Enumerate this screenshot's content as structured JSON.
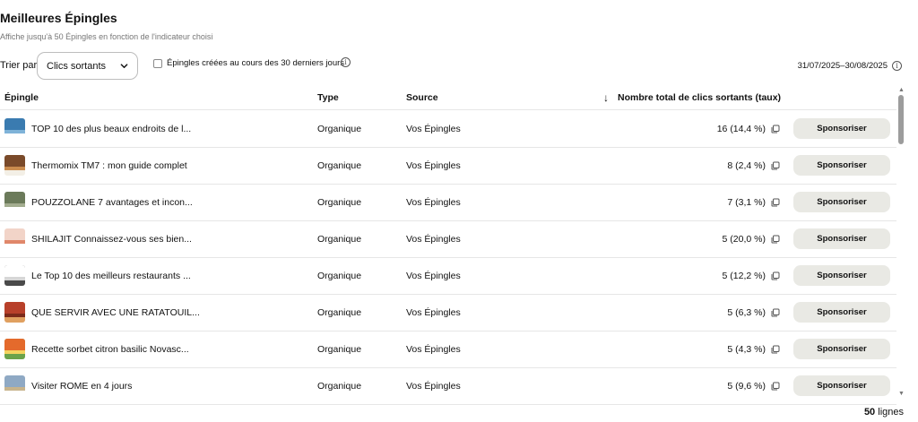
{
  "header": {
    "title": "Meilleures Épingles",
    "subtitle": "Affiche jusqu'à 50 Épingles en fonction de l'indicateur choisi"
  },
  "filters": {
    "sort_label": "Trier par",
    "sort_value": "Clics sortants",
    "checkbox_label": "Épingles créées au cours des 30 derniers jours",
    "checkbox_checked": false,
    "date_range": "31/07/2025–30/08/2025"
  },
  "table": {
    "columns": {
      "pin": "Épingle",
      "type": "Type",
      "source": "Source",
      "clicks": "Nombre total de clics sortants (taux)"
    },
    "sort_direction": "descending",
    "button_label": "Sponsoriser",
    "rows": [
      {
        "title": "TOP 10 des plus beaux endroits de l...",
        "type": "Organique",
        "source": "Vos Épingles",
        "clicks": "16 (14,4 %)",
        "thumb_colors": [
          "#3a7bb0",
          "#7fb3d8",
          "#ffffff"
        ]
      },
      {
        "title": "Thermomix TM7 : mon guide complet",
        "type": "Organique",
        "source": "Vos Épingles",
        "clicks": "8 (2,4 %)",
        "thumb_colors": [
          "#7a4a2a",
          "#c98b4e",
          "#f3efe6"
        ]
      },
      {
        "title": "POUZZOLANE 7 avantages et incon...",
        "type": "Organique",
        "source": "Vos Épingles",
        "clicks": "7 (3,1 %)",
        "thumb_colors": [
          "#6b7a5a",
          "#a3ad8f",
          "#ffffff"
        ]
      },
      {
        "title": "SHILAJIT Connaissez-vous ses bien...",
        "type": "Organique",
        "source": "Vos Épingles",
        "clicks": "5 (20,0 %)",
        "thumb_colors": [
          "#f2d4c8",
          "#e0876a",
          "#ffffff"
        ]
      },
      {
        "title": "Le Top 10 des meilleurs restaurants ...",
        "type": "Organique",
        "source": "Vos Épingles",
        "clicks": "5 (12,2 %)",
        "thumb_colors": [
          "#ffffff",
          "#d6d6d6",
          "#4a4a4a"
        ]
      },
      {
        "title": "QUE SERVIR AVEC UNE RATATOUIL...",
        "type": "Organique",
        "source": "Vos Épingles",
        "clicks": "5 (6,3 %)",
        "thumb_colors": [
          "#b8402a",
          "#7c2a1a",
          "#e0a060"
        ]
      },
      {
        "title": "Recette sorbet citron basilic Novasc...",
        "type": "Organique",
        "source": "Vos Épingles",
        "clicks": "5 (4,3 %)",
        "thumb_colors": [
          "#e46a2c",
          "#f4d35e",
          "#6ba34a"
        ]
      },
      {
        "title": "Visiter ROME en 4 jours",
        "type": "Organique",
        "source": "Vos Épingles",
        "clicks": "5 (9,6 %)",
        "thumb_colors": [
          "#8fa9c4",
          "#c8b48c",
          "#ffffff"
        ]
      }
    ]
  },
  "footer": {
    "count_number": "50",
    "count_label": "lignes"
  },
  "icons": {
    "info": "info-icon",
    "dropdown": "chevron-down-icon",
    "sort": "arrow-down-icon",
    "copy": "copy-icon",
    "scroll_up": "scroll-up-arrow",
    "scroll_down": "scroll-down-arrow"
  }
}
